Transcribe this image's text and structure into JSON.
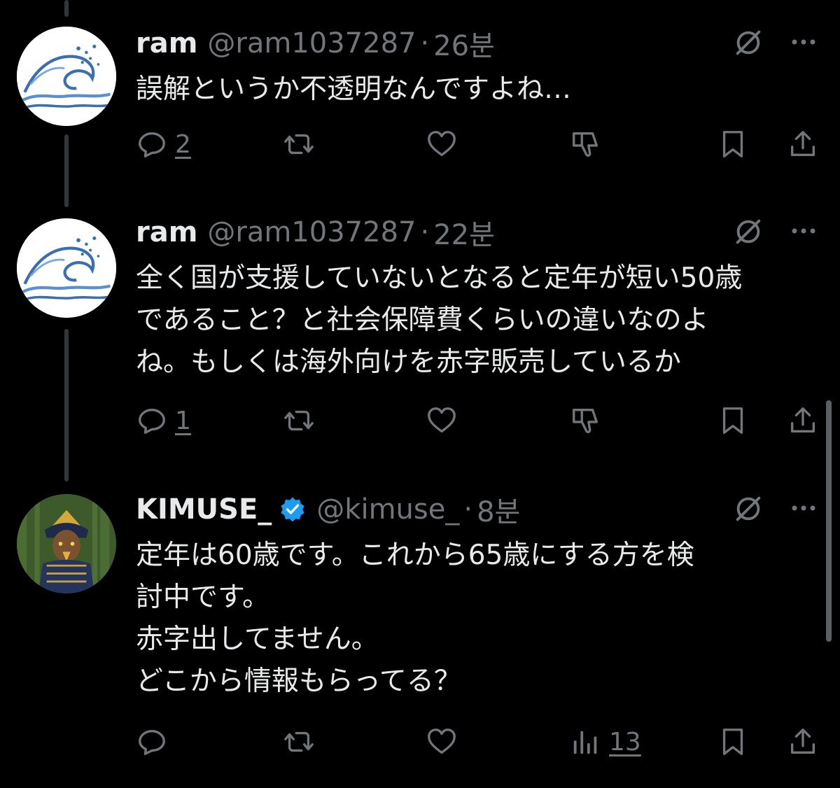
{
  "tweets": [
    {
      "name": "ram",
      "handle": "@ram1037287",
      "dot": "·",
      "time": "26분",
      "text_lines": [
        "誤解というか不透明なんですよね…"
      ],
      "reply_count": "2"
    },
    {
      "name": "ram",
      "handle": "@ram1037287",
      "dot": "·",
      "time": "22분",
      "text_lines": [
        "全く国が支援していないとなると定年が短い50歳",
        "であること？と社会保障費くらいの違いなのよ",
        "ね。もしくは海外向けを赤字販売しているか"
      ],
      "reply_count": "1"
    },
    {
      "name": "KIMUSE_",
      "handle": "@kimuse_",
      "dot": "·",
      "time": "8분",
      "text_lines": [
        "定年は60歳です。これから65歳にする方を検",
        "討中です。",
        "赤字出してません。",
        "どこから情報もらってる？"
      ],
      "views_count": "13"
    }
  ],
  "colors": {
    "background": "#000000",
    "text": "#e7e9ea",
    "muted": "#71767b",
    "verified": "#1d9bf0",
    "thread_line": "#333639"
  },
  "icons": [
    "reply-icon",
    "retweet-icon",
    "like-icon",
    "dislike-icon",
    "views-icon",
    "bookmark-icon",
    "share-icon",
    "grok-icon",
    "more-icon",
    "verified-badge-icon"
  ]
}
